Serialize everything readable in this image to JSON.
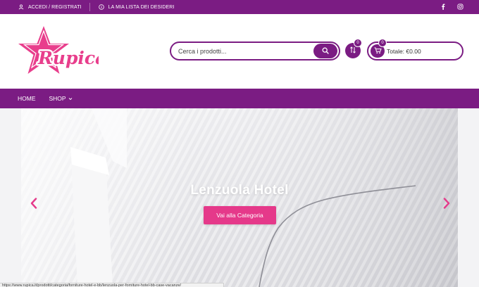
{
  "topbar": {
    "login_label": "ACCEDI / REGISTRATI",
    "wishlist_label": "LA MIA LISTA DEI DESIDERI",
    "social_icons": [
      "facebook-icon",
      "instagram-icon"
    ]
  },
  "header": {
    "logo_text": "Rupica",
    "search": {
      "placeholder": "Cerca i prodotti...",
      "value": ""
    },
    "wishlist_count": "0",
    "cart_count": "0",
    "cart_total": "Totale: €0.00"
  },
  "nav": {
    "items": [
      {
        "label": "HOME"
      },
      {
        "label": "SHOP"
      }
    ]
  },
  "slider": {
    "caption": "Lenzuola Hotel",
    "button_label": "Vai alla Categoria"
  },
  "statusbar": {
    "url": "https://www.rupica.it/prodotti/categoria/forniture-hotel-e-bb/lenzuola-per-forniture-hotel-bb-case-vacanze/"
  },
  "colors": {
    "brand_purple": "#7b1c83",
    "accent_pink": "#e5398a",
    "logo_pink": "#e83e8c"
  }
}
